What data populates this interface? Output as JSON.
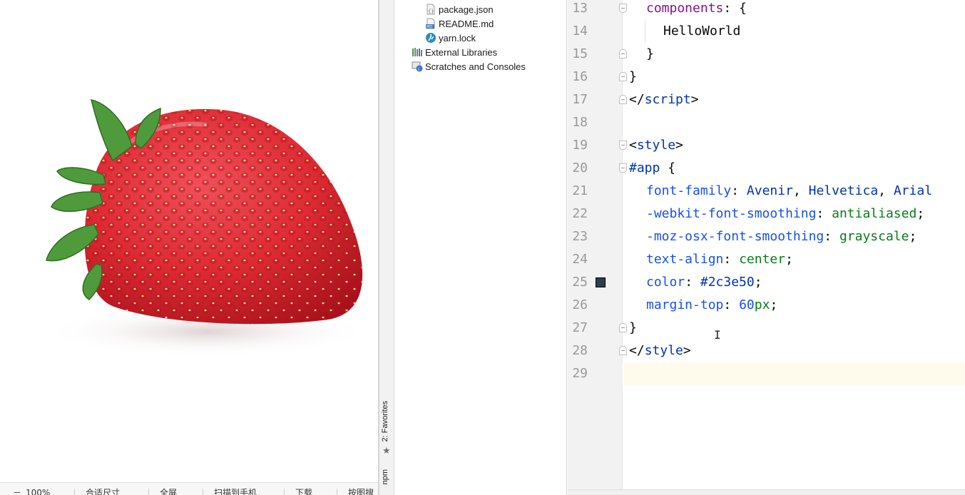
{
  "viewer": {
    "image_alt": "strawberry",
    "toolbar": {
      "zoom": "100%",
      "fit": "合适尺寸",
      "fullscreen": "全屏",
      "scan": "扫描到手机",
      "download": "下载",
      "search": "按图搜"
    }
  },
  "tool_stripe": {
    "favorites": "2: Favorites",
    "npm": "npm"
  },
  "project_tree": {
    "items": [
      {
        "label": "package.json",
        "icon": "json-file-icon"
      },
      {
        "label": "README.md",
        "icon": "markdown-file-icon"
      },
      {
        "label": "yarn.lock",
        "icon": "yarn-icon"
      },
      {
        "label": "External Libraries",
        "icon": "library-icon"
      },
      {
        "label": "Scratches and Consoles",
        "icon": "scratches-icon"
      }
    ]
  },
  "editor": {
    "line_numbers": [
      "13",
      "14",
      "15",
      "16",
      "17",
      "18",
      "19",
      "20",
      "21",
      "22",
      "23",
      "24",
      "25",
      "26",
      "27",
      "28",
      "29"
    ],
    "lines": {
      "l13": {
        "prop": "components",
        "punct": ": {"
      },
      "l14": {
        "text": "HelloWorld"
      },
      "l15": {
        "text": "}"
      },
      "l16": {
        "text": "}"
      },
      "l17": {
        "open": "</",
        "tag": "script",
        "close": ">"
      },
      "l19": {
        "open": "<",
        "tag": "style",
        "close": ">"
      },
      "l20": {
        "selector": "#app",
        "punct": " {"
      },
      "l21": {
        "prop": "font-family",
        "punct": ": ",
        "v1": "Avenir",
        "c1": ", ",
        "v2": "Helvetica",
        "c2": ", ",
        "v3": "Arial"
      },
      "l22": {
        "prop": "-webkit-font-smoothing",
        "punct": ": ",
        "value": "antialiased",
        "end": ";"
      },
      "l23": {
        "prop": "-moz-osx-font-smoothing",
        "punct": ": ",
        "value": "grayscale",
        "end": ";"
      },
      "l24": {
        "prop": "text-align",
        "punct": ": ",
        "value": "center",
        "end": ";"
      },
      "l25": {
        "prop": "color",
        "punct": ": ",
        "value": "#2c3e50",
        "end": ";"
      },
      "l26": {
        "prop": "margin-top",
        "punct": ": ",
        "num": "60",
        "unit": "px",
        "end": ";"
      },
      "l27": {
        "text": "}"
      },
      "l28": {
        "open": "</",
        "tag": "style",
        "close": ">"
      }
    },
    "swatch_color": "#2c3e50"
  }
}
